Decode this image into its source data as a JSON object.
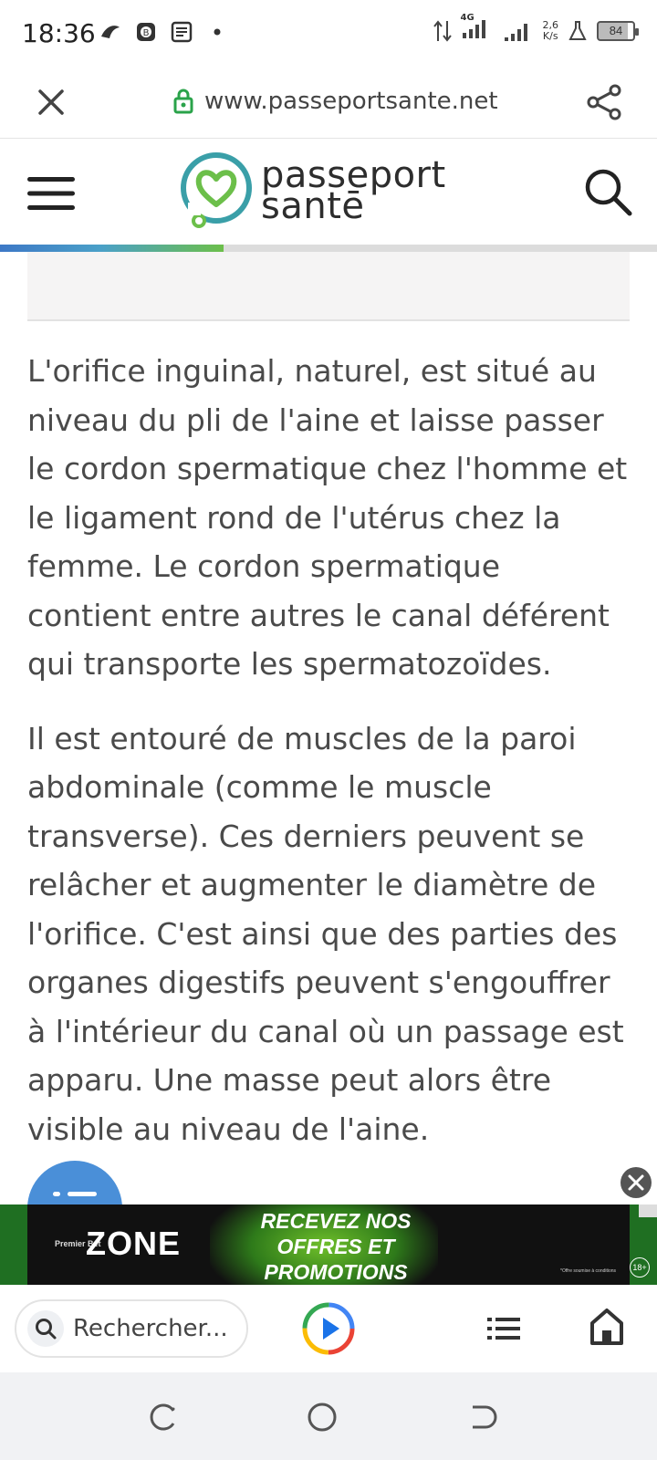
{
  "status_bar": {
    "time": "18:36",
    "network_label": "4G",
    "net_speed_value": "2,6",
    "net_speed_unit": "K/s",
    "battery": "84"
  },
  "browser": {
    "url": "www.passeportsante.net",
    "search_placeholder": "Rechercher..."
  },
  "site": {
    "logo_line1": "passeport",
    "logo_line2": "santē",
    "reading_progress": 0.34
  },
  "article": {
    "paragraphs": [
      "L'orifice inguinal, naturel, est situé au niveau du pli de l'aine et laisse passer le cordon spermatique chez l'homme et le ligament rond de l'utérus chez la femme. Le cordon spermatique contient entre autres le canal déférent qui transporte les spermatozoïdes.",
      "Il est entouré de muscles de la paroi abdominale (comme le muscle transverse). Ces derniers peuvent se relâcher et augmenter le diamètre de l'orifice. C'est ainsi que des parties des organes digestifs peuvent s'engouffrer à l'intérieur du canal où un passage est apparu. Une masse peut alors être visible au niveau de l'aine."
    ]
  },
  "ad": {
    "brand_small": "Premier Bet",
    "brand": "ZONE",
    "headline": "RECEVEZ NOS OFFRES ET PROMOTIONS",
    "fine_print": "*Offre soumise à conditions",
    "age": "18+"
  },
  "colors": {
    "accent_blue": "#4a8fd8",
    "logo_teal": "#3a9fa8",
    "logo_green": "#6cbf4a"
  },
  "icons": [
    "close-icon",
    "lock-icon",
    "share-icon",
    "hamburger-icon",
    "search-icon",
    "play-icon",
    "list-icon",
    "home-icon",
    "recent-apps-icon",
    "home-circle-icon",
    "back-icon"
  ]
}
